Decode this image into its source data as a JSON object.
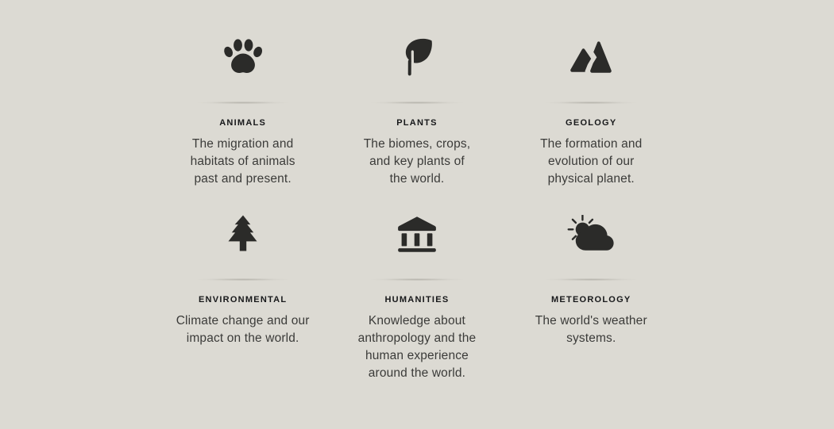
{
  "page": {
    "background_color": "#dcdad3",
    "icon_color": "#2b2b29",
    "label_color": "#17181a",
    "text_color": "#3b3b39"
  },
  "categories": [
    {
      "icon": "paw-print-icon",
      "label": "ANIMALS",
      "lines": [
        "The migration and",
        "habitats of animals",
        "past and present."
      ],
      "description": "The migration and habitats of animals past and present."
    },
    {
      "icon": "leaf-icon",
      "label": "PLANTS",
      "lines": [
        "The biomes, crops,",
        "and key plants of",
        "the world."
      ],
      "description": "The biomes, crops, and key plants of the world."
    },
    {
      "icon": "mountains-icon",
      "label": "GEOLOGY",
      "lines": [
        "The formation and",
        "evolution of our",
        "physical planet."
      ],
      "description": "The formation and evolution of our physical planet."
    },
    {
      "icon": "evergreen-tree-icon",
      "label": "ENVIRONMENTAL",
      "lines": [
        "Climate change and our",
        "impact on the world."
      ],
      "description": "Climate change and our impact on the world."
    },
    {
      "icon": "museum-building-icon",
      "label": "HUMANITIES",
      "lines": [
        "Knowledge about",
        "anthropology and the",
        "human experience",
        "around the world."
      ],
      "description": "Knowledge about anthropology and the human experience around the world."
    },
    {
      "icon": "sun-behind-cloud-icon",
      "label": "METEOROLOGY",
      "lines": [
        "The world's weather",
        "systems."
      ],
      "description": "The world's weather systems."
    }
  ]
}
